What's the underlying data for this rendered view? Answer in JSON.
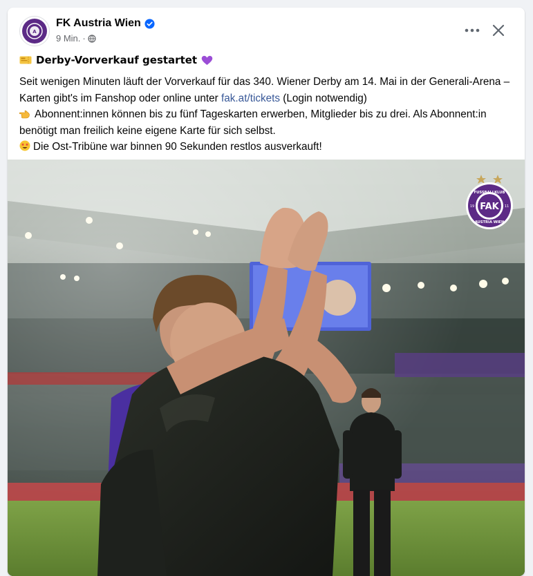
{
  "post": {
    "page_name": "FK Austria Wien",
    "timestamp": "9 Min.",
    "dot": "·",
    "title": "Derby-Vorverkauf gestartet",
    "body_line1_pre": "Seit wenigen Minuten läuft der Vorverkauf für das 340. Wiener Derby am 14. Mai in der Generali-Arena – Karten gibt's im Fanshop oder online unter ",
    "body_link": "fak.at/tickets",
    "body_line1_post": " (Login notwendig)",
    "body_line2": "Abonnent:innen können bis zu fünf Tageskarten erwerben, Mitglieder bis zu drei. Als Abonnent:in benötigt man freilich keine eigene Karte für sich selbst.",
    "body_line3": "Die Ost-Tribüne war binnen 90 Sekunden restlos ausverkauft!"
  },
  "photo": {
    "club_logo_text_top": "FUSSBALLKLUB",
    "club_logo_text_bottom": "AUSTRIA WIEN",
    "club_logo_letters": "FAK",
    "club_logo_year_left": "19",
    "club_logo_year_right": "11"
  },
  "icons": {
    "title_left": "ticket-icon",
    "title_right": "purple-heart-icon",
    "line2": "pointing-hand-icon",
    "line3": "star-struck-icon"
  },
  "colors": {
    "brand_purple": "#5c2a86",
    "link": "#385898",
    "verified": "#0866ff",
    "meta_gray": "#65676b"
  }
}
